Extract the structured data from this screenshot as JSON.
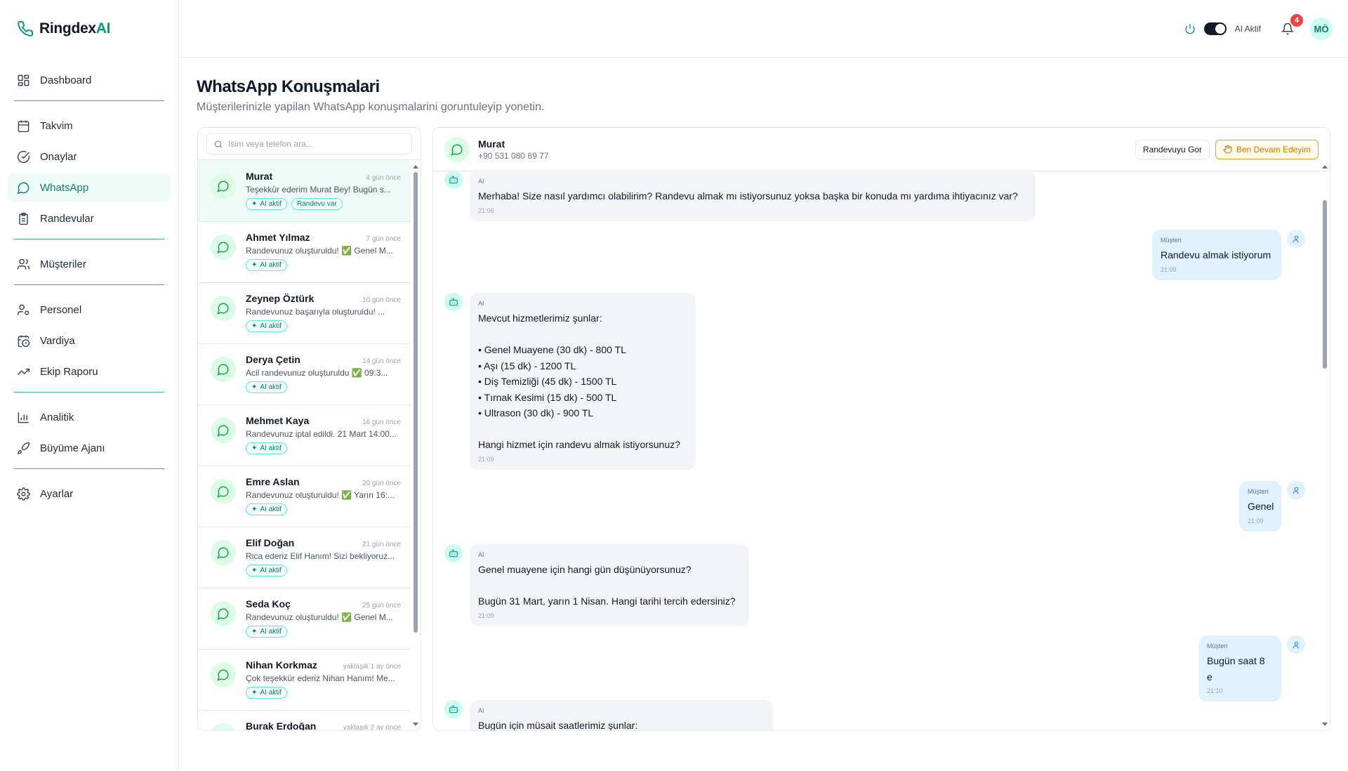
{
  "app": {
    "brand_main": "Ringdex",
    "brand_ai": "AI"
  },
  "sidebar": {
    "items": [
      {
        "label": "Dashboard"
      },
      {
        "label": "Takvim"
      },
      {
        "label": "Onaylar"
      },
      {
        "label": "WhatsApp"
      },
      {
        "label": "Randevular"
      },
      {
        "label": "Müşteriler"
      },
      {
        "label": "Personel"
      },
      {
        "label": "Vardiya"
      },
      {
        "label": "Ekip Raporu"
      },
      {
        "label": "Analitik"
      },
      {
        "label": "Büyüme Ajanı"
      },
      {
        "label": "Ayarlar"
      }
    ],
    "active_index": 3
  },
  "header": {
    "ai_toggle_label": "AI Aktif",
    "notification_count": "4",
    "avatar_initials": "MÖ"
  },
  "page": {
    "title": "WhatsApp Konuşmalari",
    "subtitle": "Müşterilerinizle yapilan WhatsApp konuşmalarini goruntuleyip yonetin."
  },
  "search": {
    "placeholder": "Isim veya telefon ara..."
  },
  "conversations": [
    {
      "name": "Murat",
      "time": "4 gün önce",
      "preview": "Teşekkür ederim Murat Bey! Bugün s...",
      "tags": [
        "AI aktif",
        "Randevu var"
      ]
    },
    {
      "name": "Ahmet Yılmaz",
      "time": "7 gün önce",
      "preview": "Randevunuz oluşturuldu! ✅ Genel M...",
      "tags": [
        "AI aktif"
      ]
    },
    {
      "name": "Zeynep Öztürk",
      "time": "10 gün önce",
      "preview": "Randevunuz başarıyla oluşturuldu! ...",
      "tags": [
        "AI aktif"
      ]
    },
    {
      "name": "Derya Çetin",
      "time": "14 gün önce",
      "preview": "Acil randevunuz oluşturuldu ✅ 09:3...",
      "tags": [
        "AI aktif"
      ]
    },
    {
      "name": "Mehmet Kaya",
      "time": "16 gün önce",
      "preview": "Randevunuz iptal edildi. 21 Mart 14:00...",
      "tags": [
        "AI aktif"
      ]
    },
    {
      "name": "Emre Aslan",
      "time": "20 gün önce",
      "preview": "Randevunuz oluşturuldu! ✅ Yarın 16:...",
      "tags": [
        "AI aktif"
      ]
    },
    {
      "name": "Elif Doğan",
      "time": "21 gün önce",
      "preview": "Rica ederiz Elif Hanım! Sizi bekliyoruz...",
      "tags": [
        "AI aktif"
      ]
    },
    {
      "name": "Seda Koç",
      "time": "25 gün önce",
      "preview": "Randevunuz oluşturuldu! ✅ Genel M...",
      "tags": [
        "AI aktif"
      ]
    },
    {
      "name": "Nihan Korkmaz",
      "time": "yaklaşık 1 ay önce",
      "preview": "Çok teşekkür ederiz Nihan Hanım! Me...",
      "tags": [
        "AI aktif"
      ]
    },
    {
      "name": "Burak Erdoğan",
      "time": "yaklaşık 2 ay önce",
      "preview": "",
      "tags": []
    }
  ],
  "chat": {
    "name": "Murat",
    "phone": "+90 531 080 69 77",
    "view_appointment_label": "Randevuyu Gor",
    "take_over_label": "Ben Devam Edeyim",
    "messages": [
      {
        "sender": "AI",
        "text": "Merhaba! Size nasıl yardımcı olabilirim? Randevu almak mı istiyorsunuz yoksa başka bir konuda mı yardıma ihtiyacınız var?",
        "time": "21:06"
      },
      {
        "sender": "Müşteri",
        "text": "Randevu almak istiyorum",
        "time": "21:09"
      },
      {
        "sender": "AI",
        "text": "Mevcut hizmetlerimiz şunlar:\n\n• Genel Muayene (30 dk) - 800 TL\n• Aşı (15 dk) - 1200 TL\n• Diş Temizliği (45 dk) - 1500 TL\n• Tırnak Kesimi (15 dk) - 500 TL\n• Ultrason (30 dk) - 900 TL\n\nHangi hizmet için randevu almak istiyorsunuz?",
        "time": "21:09"
      },
      {
        "sender": "Müşteri",
        "text": "Genel",
        "time": "21:09"
      },
      {
        "sender": "AI",
        "text": "Genel muayene için hangi gün düşünüyorsunuz?\n\nBugün 31 Mart, yarın 1 Nisan. Hangi tarihi tercih edersiniz?",
        "time": "21:09"
      },
      {
        "sender": "Müşteri",
        "text": "Bugün saat 8 e",
        "time": "21:10"
      },
      {
        "sender": "AI",
        "text": "Bugün için müsait saatlerimiz şunlar:",
        "time": ""
      }
    ]
  },
  "colors": {
    "accent": "#0d9488",
    "active_bg": "#eefaf6",
    "badge": "#ef4444",
    "warning": "#d97706"
  }
}
